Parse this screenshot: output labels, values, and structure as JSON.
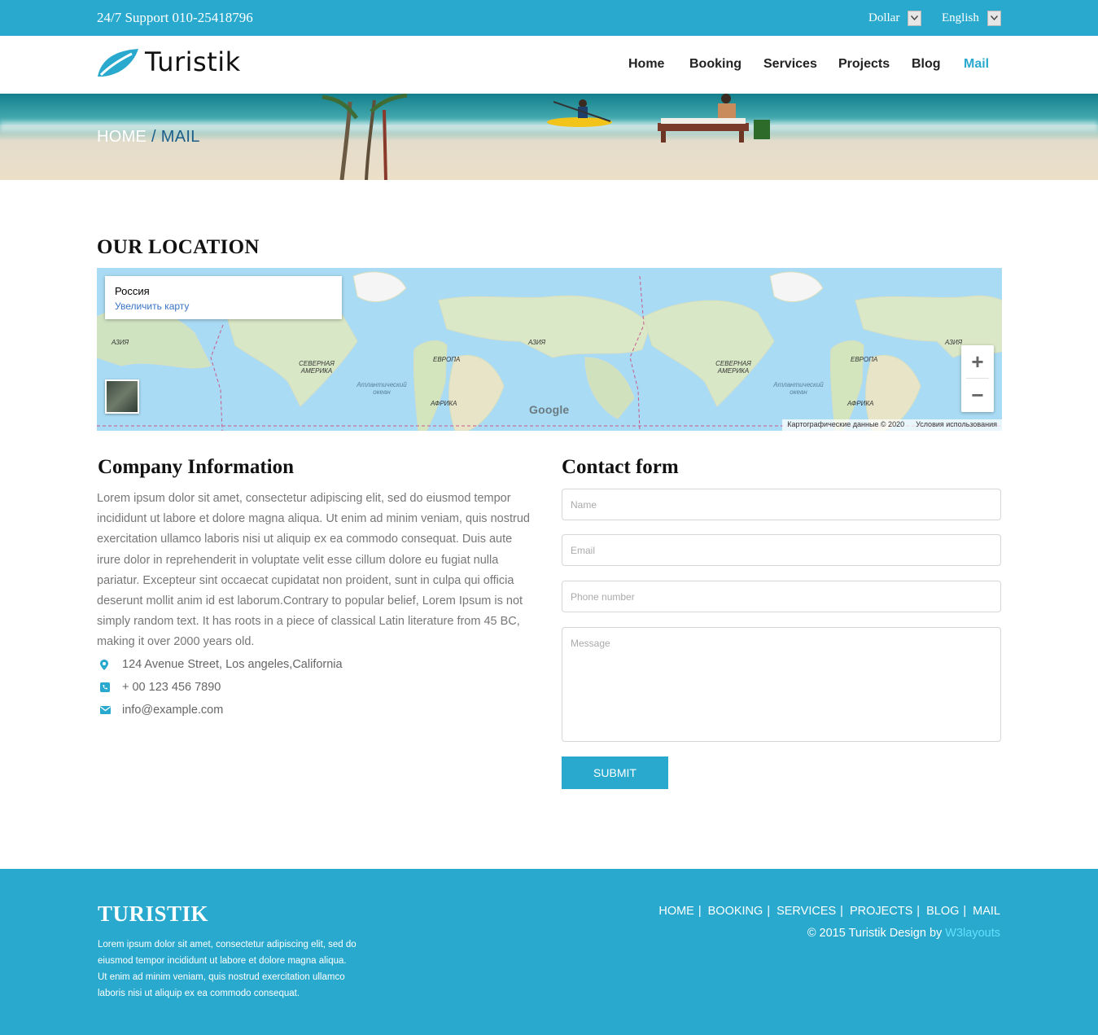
{
  "topbar": {
    "support": "24/7 Support 010-25418796",
    "currency": "Dollar",
    "language": "English"
  },
  "header": {
    "logo_text": "Turistik",
    "nav": [
      "Home",
      "Booking",
      "Services",
      "Projects",
      "Blog",
      "Mail"
    ],
    "active": "Mail"
  },
  "banner": {
    "crumb_home": "HOME",
    "crumb_sep": " / ",
    "crumb_current": "MAIL"
  },
  "location": {
    "heading": "OUR LOCATION",
    "map_title": "Россия",
    "map_link": "Увеличить карту",
    "map_data": "Картографические данные © 2020",
    "map_terms": "Условия использования",
    "google": "Google",
    "labels": [
      "АЗИЯ",
      "СЕВЕРНАЯ АМЕРИКА",
      "ЕВРОПА",
      "АЗИЯ",
      "Атлантический океан",
      "АФРИКА",
      "СЕВЕРНАЯ АМЕРИКА",
      "ЕВРОПА",
      "АЗИЯ",
      "Атлантический океан",
      "АФРИКА"
    ]
  },
  "company": {
    "heading": "Company Information",
    "about": "Lorem ipsum dolor sit amet, consectetur adipiscing elit, sed do eiusmod tempor incididunt ut labore et dolore magna aliqua. Ut enim ad minim veniam, quis nostrud exercitation ullamco laboris nisi ut aliquip ex ea commodo consequat. Duis aute irure dolor in reprehenderit in voluptate velit esse cillum dolore eu fugiat nulla pariatur. Excepteur sint occaecat cupidatat non proident, sunt in culpa qui officia deserunt mollit anim id est laborum.Contrary to popular belief, Lorem Ipsum is not simply random text. It has roots in a piece of classical Latin literature from 45 BC, making it over 2000 years old.",
    "address": "124 Avenue Street, Los angeles,California",
    "phone": "+ 00 123 456 7890",
    "email": "info@example.com"
  },
  "contact": {
    "heading": "Contact form",
    "name_placeholder": "Name",
    "email_placeholder": "Email",
    "phone_placeholder": "Phone number",
    "message_placeholder": "Message",
    "submit": "SUBMIT"
  },
  "footer": {
    "brand": "TURISTIK",
    "text": "Lorem ipsum dolor sit amet, consectetur adipiscing elit, sed do eiusmod tempor incididunt ut labore et dolore magna aliqua. Ut enim ad minim veniam, quis nostrud exercitation ullamco laboris nisi ut aliquip ex ea commodo consequat.",
    "nav": [
      "HOME",
      "BOOKING",
      "SERVICES",
      "PROJECTS",
      "BLOG",
      "MAIL"
    ],
    "copyright": "© 2015 Turistik Design by ",
    "credit": "W3layouts"
  },
  "colors": {
    "accent": "#29a9ce",
    "crumb_current": "#1b5e8a",
    "credit_link": "#5fe2ff"
  }
}
